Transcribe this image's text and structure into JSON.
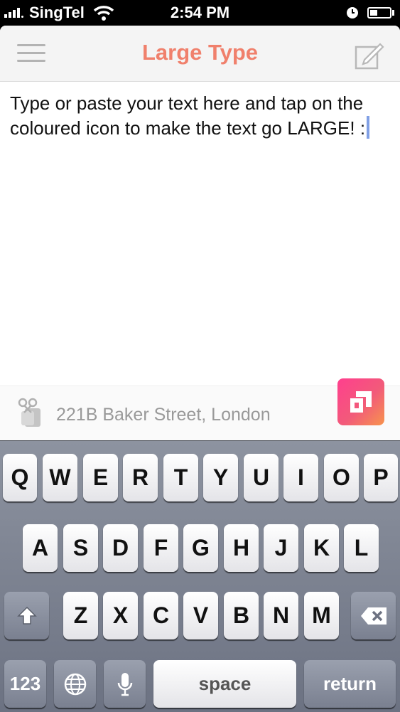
{
  "status_bar": {
    "carrier": "SingTel",
    "time": "2:54 PM"
  },
  "nav": {
    "title": "Large Type",
    "menu_icon": "hamburger-menu-icon",
    "compose_icon": "compose-icon"
  },
  "editor": {
    "text": "Type or paste your text here and tap on the coloured icon to make the text go LARGE! :"
  },
  "location": {
    "text": "221B Baker Street, London",
    "icon": "clipboard-scissors-icon"
  },
  "keyboard": {
    "row1": [
      "Q",
      "W",
      "E",
      "R",
      "T",
      "Y",
      "U",
      "I",
      "O",
      "P"
    ],
    "row2": [
      "A",
      "S",
      "D",
      "F",
      "G",
      "H",
      "J",
      "K",
      "L"
    ],
    "row3": [
      "Z",
      "X",
      "C",
      "V",
      "B",
      "N",
      "M"
    ],
    "numbers_key": "123",
    "space_key": "space",
    "return_key": "return"
  },
  "colors": {
    "title": "#f0806c",
    "accent_gradient_start": "#ff3f8e",
    "accent_gradient_end": "#f7944c"
  }
}
